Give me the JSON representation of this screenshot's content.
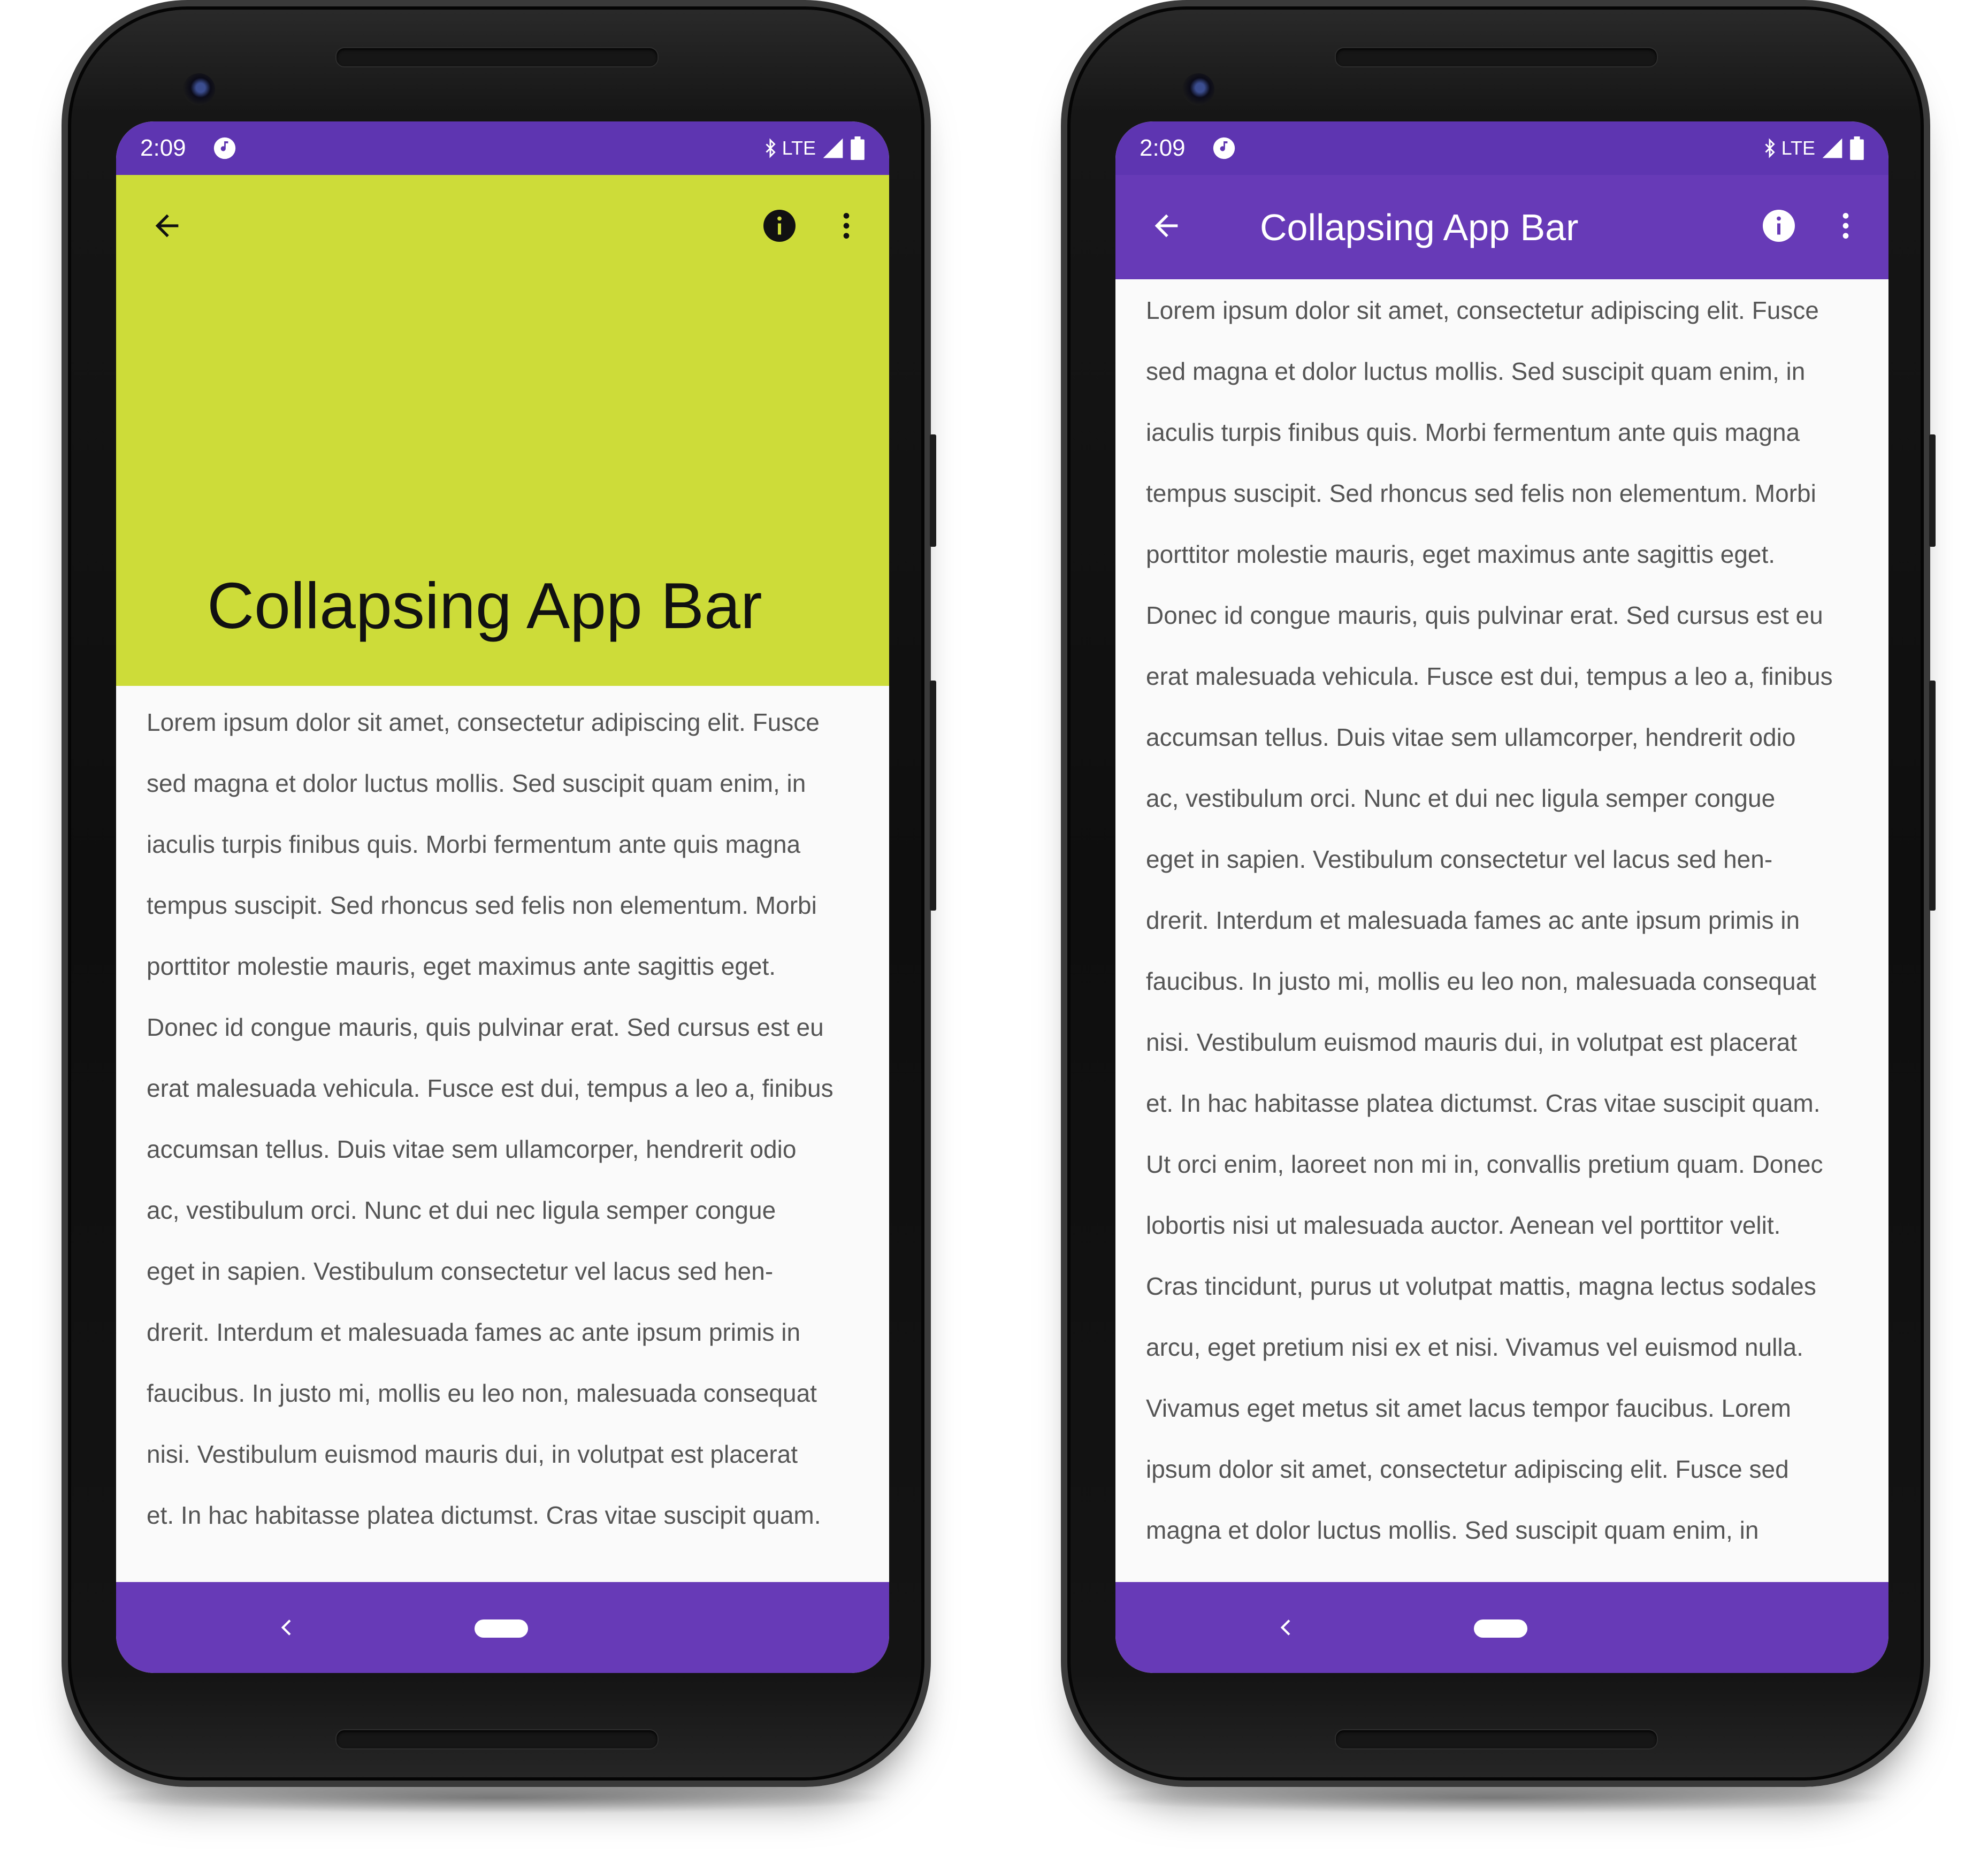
{
  "colors": {
    "status_bar": "#5e35b1",
    "app_bar_expanded": "#cddc39",
    "app_bar_collapsed": "#673ab7",
    "nav_bar": "#673ab7",
    "content_bg": "#fafafa"
  },
  "status": {
    "time": "2:09",
    "network": "LTE",
    "icons": [
      "music-note-icon",
      "bluetooth-icon",
      "signal-icon",
      "battery-icon"
    ]
  },
  "app_bar": {
    "title": "Collapsing App Bar",
    "icons": [
      "back-arrow-icon",
      "info-icon",
      "more-vert-icon"
    ]
  },
  "body_lines": [
    "Lorem ipsum dolor sit amet, consectetur adipiscing elit. Fusce",
    "sed magna et dolor luctus mollis. Sed suscipit quam enim, in",
    "iaculis turpis finibus quis. Morbi fermentum ante quis magna",
    "tempus suscipit. Sed rhoncus sed felis non elementum. Morbi",
    "porttitor molestie mauris, eget maximus ante sagittis eget.",
    "Donec id congue mauris, quis pulvinar erat. Sed cursus est eu",
    "erat malesuada vehicula. Fusce est dui, tempus a leo a, finibus",
    "accumsan tellus. Duis vitae sem ullamcorper, hendrerit odio",
    "ac, vestibulum orci. Nunc et dui nec ligula semper congue",
    "eget in sapien. Vestibulum consectetur vel lacus sed hen-",
    "drerit. Interdum et malesuada fames ac ante ipsum primis in",
    "faucibus. In justo mi, mollis eu leo non, malesuada consequat",
    "nisi. Vestibulum euismod mauris dui, in volutpat est placerat",
    "et. In hac habitasse platea dictumst. Cras vitae suscipit quam.",
    "Ut orci enim, laoreet non mi in, convallis pretium quam. Donec",
    "lobortis nisi ut malesuada auctor. Aenean vel porttitor velit.",
    "Cras tincidunt, purus ut volutpat mattis, magna lectus sodales",
    "arcu, eget pretium nisi ex et nisi. Vivamus vel euismod nulla.",
    "Vivamus eget metus sit amet lacus tempor faucibus. Lorem",
    "ipsum dolor sit amet, consectetur adipiscing elit. Fusce sed",
    "magna et dolor luctus mollis. Sed suscipit quam enim, in"
  ],
  "nav": {
    "icons": [
      "nav-back-icon",
      "home-pill-icon"
    ]
  }
}
